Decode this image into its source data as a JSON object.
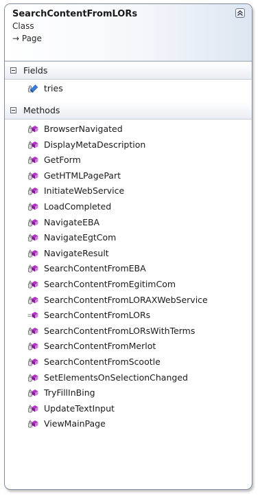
{
  "class_name": "SearchContentFromLORs",
  "stereotype": "Class",
  "base_class": "→ Page",
  "fields_section": {
    "label": "Fields",
    "items": [
      {
        "name": "tries",
        "icon": "field-icon"
      }
    ]
  },
  "methods_section": {
    "label": "Methods",
    "items": [
      {
        "name": "BrowserNavigated",
        "icon": "private-method-icon"
      },
      {
        "name": "DisplayMetaDescription",
        "icon": "private-method-icon"
      },
      {
        "name": "GetForm",
        "icon": "private-method-icon"
      },
      {
        "name": "GetHTMLPagePart",
        "icon": "private-method-icon"
      },
      {
        "name": "InitiateWebService",
        "icon": "private-method-icon"
      },
      {
        "name": "LoadCompleted",
        "icon": "private-method-icon"
      },
      {
        "name": "NavigateEBA",
        "icon": "private-method-icon"
      },
      {
        "name": "NavigateEgtCom",
        "icon": "private-method-icon"
      },
      {
        "name": "NavigateResult",
        "icon": "private-method-icon"
      },
      {
        "name": "SearchContentFromEBA",
        "icon": "private-method-icon"
      },
      {
        "name": "SearchContentFromEgitimCom",
        "icon": "private-method-icon"
      },
      {
        "name": "SearchContentFromLORAXWebService",
        "icon": "private-method-icon"
      },
      {
        "name": "SearchContentFromLORs",
        "icon": "public-method-icon"
      },
      {
        "name": "SearchContentFromLORsWithTerms",
        "icon": "private-method-icon"
      },
      {
        "name": "SearchContentFromMerlot",
        "icon": "private-method-icon"
      },
      {
        "name": "SearchContentFromScootle",
        "icon": "private-method-icon"
      },
      {
        "name": "SetElementsOnSelectionChanged",
        "icon": "private-method-icon"
      },
      {
        "name": "TryFillInBing",
        "icon": "private-method-icon"
      },
      {
        "name": "UpdateTextInput",
        "icon": "private-method-icon"
      },
      {
        "name": "ViewMainPage",
        "icon": "private-method-icon"
      }
    ]
  },
  "colors": {
    "method_icon": "#b531c8",
    "field_icon": "#3a7bd5",
    "border": "#7f8a9a"
  }
}
